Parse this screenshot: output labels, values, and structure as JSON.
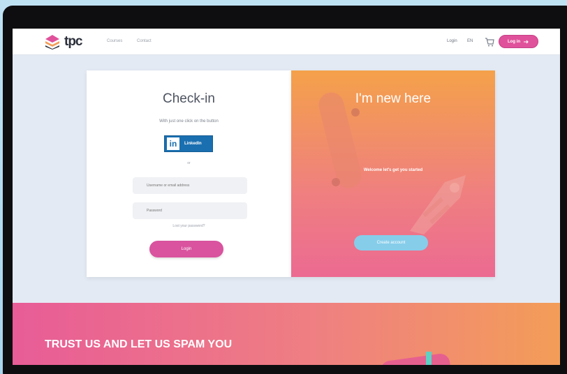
{
  "nav": {
    "brand": "tpc",
    "links": [
      "Courses",
      "Contact"
    ],
    "right_items": [
      "Login",
      "EN"
    ],
    "login_button": "Log in"
  },
  "checkin": {
    "title": "Check-in",
    "subtitle": "With just one click on the button",
    "linkedin_label": "LinkedIn",
    "or": "or",
    "username_placeholder": "Username or email address",
    "password_placeholder": "Password",
    "forgot": "Lost your password?",
    "login_button": "Login"
  },
  "signup": {
    "title": "I'm new here",
    "welcome": "Welcome let's get you started",
    "create_button": "Create account"
  },
  "band": {
    "title": "TRUST US AND LET US SPAM YOU"
  },
  "colors": {
    "accent_pink": "#e0519b",
    "linkedin_blue": "#1a6fb0",
    "signup_button": "#86cdea",
    "gradient_orange": "#f4a14a"
  },
  "icons": [
    "logo-icon",
    "cart-icon",
    "linkedin-icon",
    "login-arrow-icon"
  ]
}
